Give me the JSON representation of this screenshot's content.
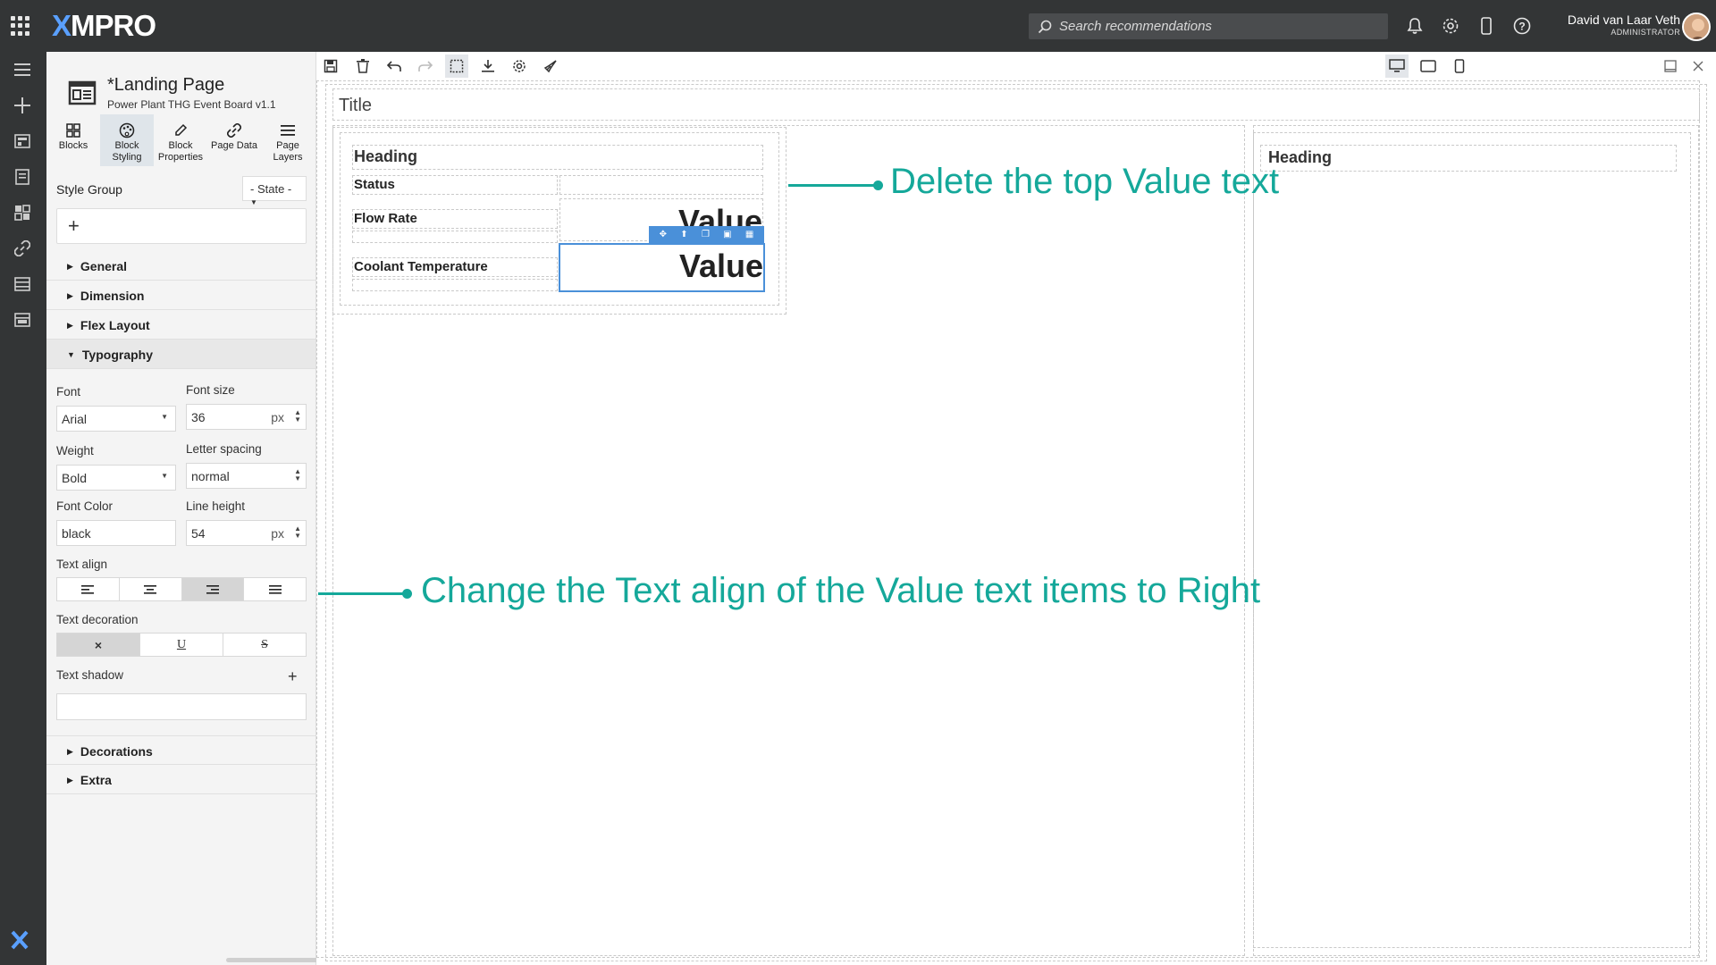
{
  "app": {
    "logo_prefix": "X",
    "logo_rest": "MPRO"
  },
  "search": {
    "placeholder": "Search recommendations"
  },
  "user": {
    "name": "David van Laar Veth",
    "role": "ADMINISTRATOR"
  },
  "page": {
    "title": "*Landing Page",
    "subtitle": "Power Plant THG Event Board v1.1"
  },
  "tabs": [
    {
      "label": "Blocks",
      "icon": "blocks-icon"
    },
    {
      "label": "Block Styling",
      "icon": "palette-icon",
      "active": true
    },
    {
      "label": "Block Properties",
      "icon": "pencil-icon"
    },
    {
      "label": "Page Data",
      "icon": "link-icon"
    },
    {
      "label": "Page Layers",
      "icon": "layers-icon"
    }
  ],
  "style_group": {
    "label": "Style Group",
    "value": "- State -",
    "add": "+"
  },
  "sections": {
    "general": "General",
    "dimension": "Dimension",
    "flex_layout": "Flex Layout",
    "typography": "Typography",
    "decorations": "Decorations",
    "extra": "Extra"
  },
  "typography": {
    "font_label": "Font",
    "font_value": "Arial",
    "font_size_label": "Font size",
    "font_size_value": "36",
    "font_size_unit": "px",
    "weight_label": "Weight",
    "weight_value": "Bold",
    "letter_spacing_label": "Letter spacing",
    "letter_spacing_value": "normal",
    "font_color_label": "Font Color",
    "font_color_value": "black",
    "line_height_label": "Line height",
    "line_height_value": "54",
    "line_height_unit": "px",
    "text_align_label": "Text align",
    "text_align_active": "right",
    "text_decoration_label": "Text decoration",
    "text_decoration_active": "none",
    "text_decoration_options": {
      "none": "×",
      "underline": "U",
      "strike": "S"
    },
    "text_shadow_label": "Text shadow",
    "text_shadow_add": "+"
  },
  "canvas": {
    "title": "Title",
    "left_card": {
      "heading": "Heading",
      "rows": [
        {
          "label": "Status",
          "value": ""
        },
        {
          "label": "Flow Rate",
          "value": "Value"
        },
        {
          "label": "Coolant Temperature",
          "value": "Value"
        }
      ]
    },
    "right_card": {
      "heading": "Heading"
    }
  },
  "annotations": {
    "top": "Delete the top Value text",
    "middle": "Change the Text align of the Value text items to Right"
  },
  "colors": {
    "accent": "#4a90d9",
    "annotation": "#15a89a",
    "chrome": "#333536"
  }
}
